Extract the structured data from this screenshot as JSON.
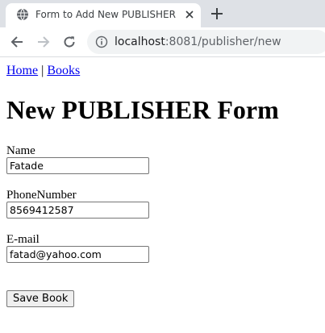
{
  "browser": {
    "tab_title": "Form to Add New PUBLISHER",
    "url_host": "localhost",
    "url_rest": ":8081/publisher/new"
  },
  "page": {
    "nav": {
      "home": "Home",
      "separator": "|",
      "books": "Books"
    },
    "heading": "New PUBLISHER Form",
    "fields": {
      "name": {
        "label": "Name",
        "value": "Fatade"
      },
      "phone": {
        "label": "PhoneNumber",
        "value": "8569412587"
      },
      "email": {
        "label": "E-mail",
        "value": "fatad@yahoo.com"
      }
    },
    "save_button": "Save Book"
  },
  "colors": {
    "link": "#0000ee",
    "tabstrip": "#dee1e6",
    "omnibox": "#f1f3f4"
  },
  "icons": [
    "globe-icon",
    "close-icon",
    "plus-icon",
    "back-icon",
    "forward-icon",
    "reload-icon",
    "info-icon"
  ]
}
